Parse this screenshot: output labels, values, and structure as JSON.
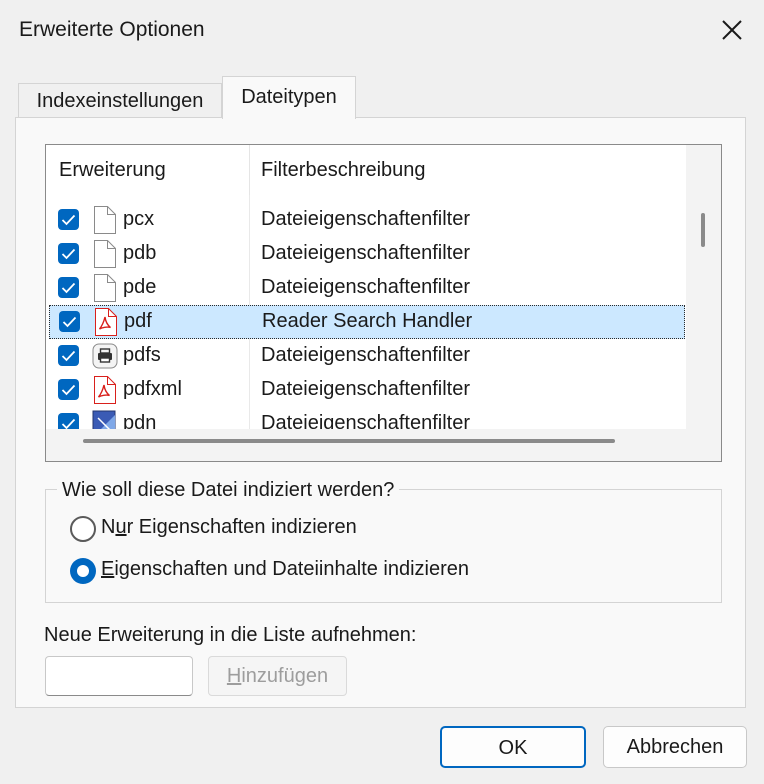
{
  "window": {
    "title": "Erweiterte Optionen"
  },
  "tabs": [
    {
      "label": "Indexeinstellungen",
      "active": false
    },
    {
      "label": "Dateitypen",
      "active": true
    }
  ],
  "list": {
    "columns": [
      "Erweiterung",
      "Filterbeschreibung"
    ],
    "rows": [
      {
        "ext": "pcx",
        "desc": "Dateieigenschaftenfilter",
        "icon": "generic-file-icon",
        "checked": true
      },
      {
        "ext": "pdb",
        "desc": "Dateieigenschaftenfilter",
        "icon": "generic-file-icon",
        "checked": true
      },
      {
        "ext": "pde",
        "desc": "Dateieigenschaftenfilter",
        "icon": "generic-file-icon",
        "checked": true
      },
      {
        "ext": "pdf",
        "desc": "Reader Search Handler",
        "icon": "pdf-file-icon",
        "checked": true,
        "selected": true
      },
      {
        "ext": "pdfs",
        "desc": "Dateieigenschaftenfilter",
        "icon": "printer-file-icon",
        "checked": true
      },
      {
        "ext": "pdfxml",
        "desc": "Dateieigenschaftenfilter",
        "icon": "pdf-file-icon",
        "checked": true
      },
      {
        "ext": "pdn",
        "desc": "Dateieigenschaftenfilter",
        "icon": "image-file-icon",
        "checked": true
      }
    ]
  },
  "index_group": {
    "legend": "Wie soll diese Datei indiziert werden?",
    "option_props_prefix": "N",
    "option_props_mnemonic": "u",
    "option_props_rest": "r Eigenschaften indizieren",
    "option_content_mnemonic": "E",
    "option_content_rest": "igenschaften und Dateiinhalte indizieren",
    "selected": "content"
  },
  "new_extension": {
    "label": "Neue Erweiterung in die Liste aufnehmen:",
    "value": "",
    "add_mnemonic": "H",
    "add_rest": "inzufügen"
  },
  "buttons": {
    "ok": "OK",
    "cancel": "Abbrechen"
  },
  "colors": {
    "accent": "#0067c0",
    "selection": "#cce8ff",
    "pdf_red": "#d9201c"
  }
}
